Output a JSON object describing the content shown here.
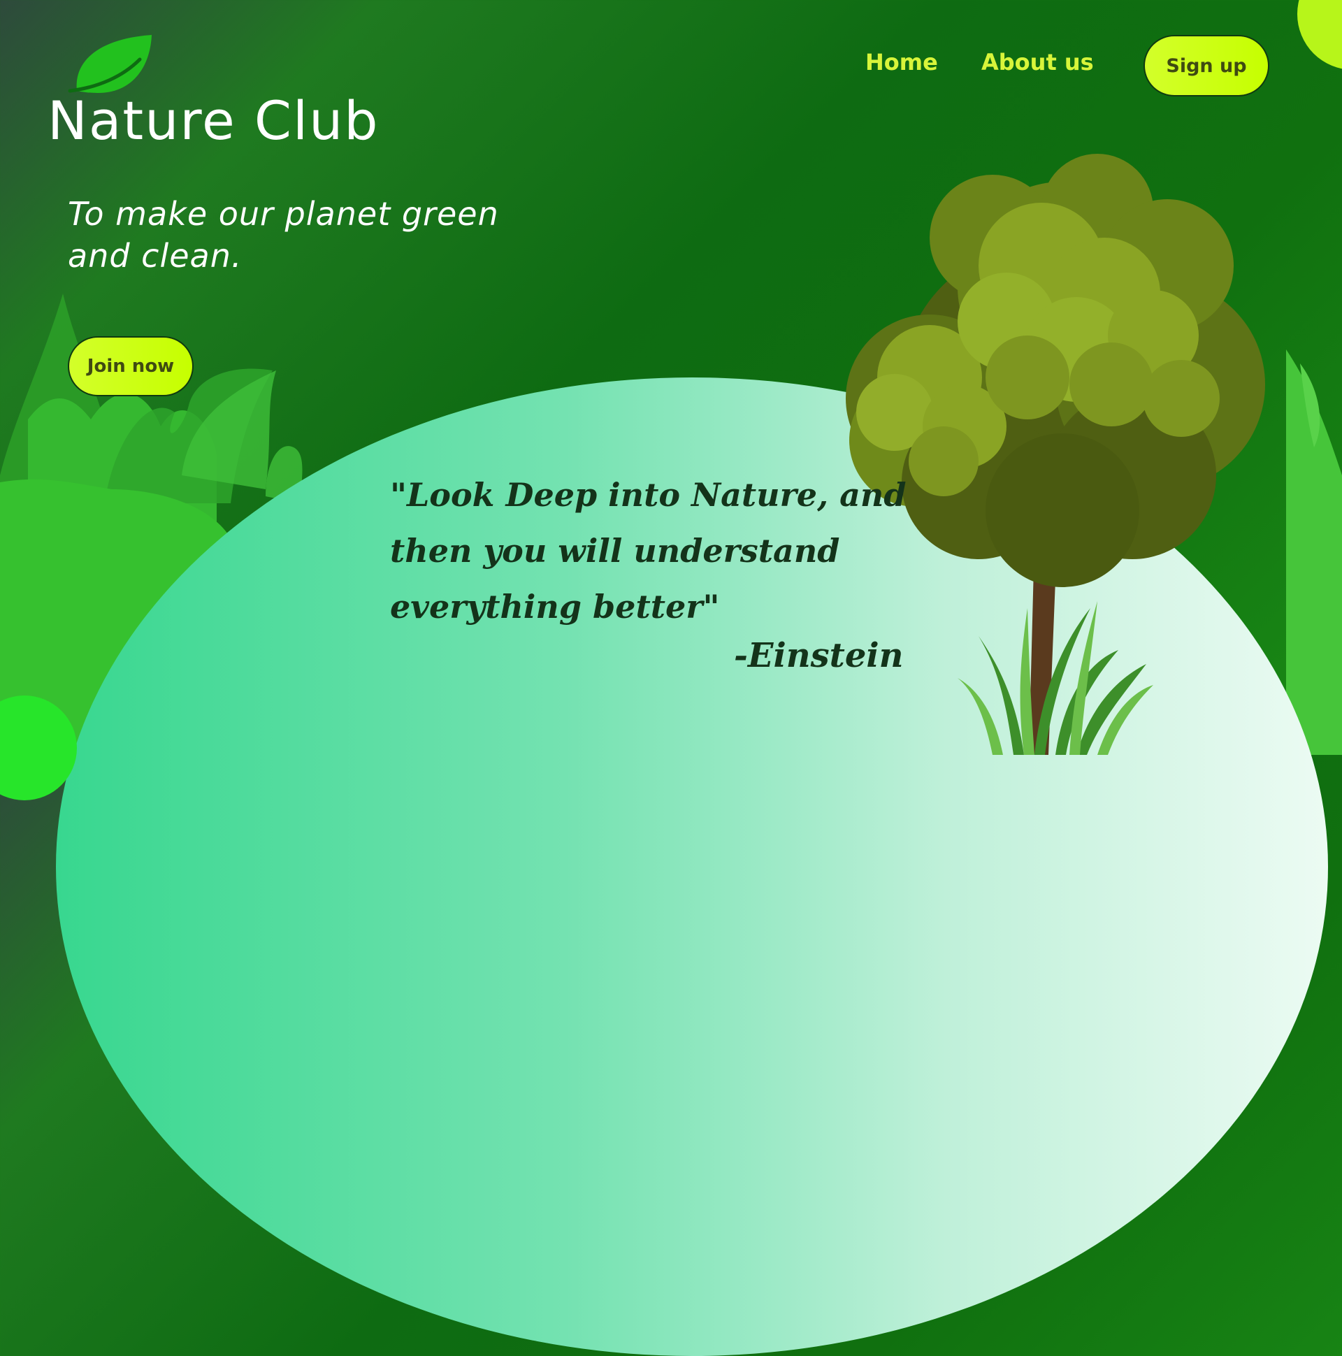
{
  "header": {
    "brand_name": "Nature Club",
    "logo_icon": "leaf-icon",
    "nav": [
      {
        "label": "Home"
      },
      {
        "label": "About us"
      }
    ],
    "signup_label": "Sign up"
  },
  "hero": {
    "tagline": "To make our planet green and clean.",
    "join_label": "Join now"
  },
  "quote": {
    "text": "\"Look Deep into Nature, and then you will understand everything better\"",
    "author": "-Einstein"
  },
  "colors": {
    "accent": "#c6ff00",
    "nav_text": "#d8f53a",
    "background_green": "#0e6b12",
    "hill_light": "#bff0d9",
    "quote_text": "#14331a"
  }
}
